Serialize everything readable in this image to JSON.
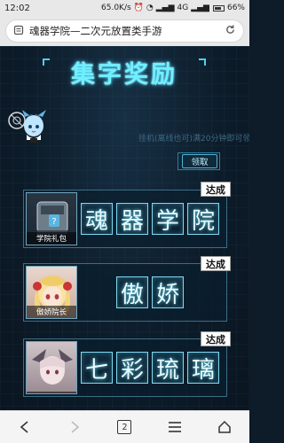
{
  "status_bar": {
    "time": "12:02",
    "net_speed": "65.0K/s",
    "network": "4G",
    "battery": "66%"
  },
  "address_bar": {
    "title": "魂器学院—二次元放置类手游"
  },
  "game": {
    "banner_title": "集字奖励",
    "notice": "挂机(离线也可)满20分钟即可领",
    "receive_label": "领取",
    "rewards": [
      {
        "item_label": "学院礼包",
        "chars": [
          "魂",
          "器",
          "学",
          "院"
        ],
        "status": "达成"
      },
      {
        "item_label": "傲娇院长",
        "chars": [
          "傲",
          "娇"
        ],
        "status": "达成"
      },
      {
        "item_label": "",
        "chars": [
          "七",
          "彩",
          "琉",
          "璃"
        ],
        "status": "达成"
      }
    ]
  },
  "bottom_nav": {
    "tab_count": "2"
  },
  "colors": {
    "accent": "#6ff0ff",
    "background": "#0e1b29"
  }
}
